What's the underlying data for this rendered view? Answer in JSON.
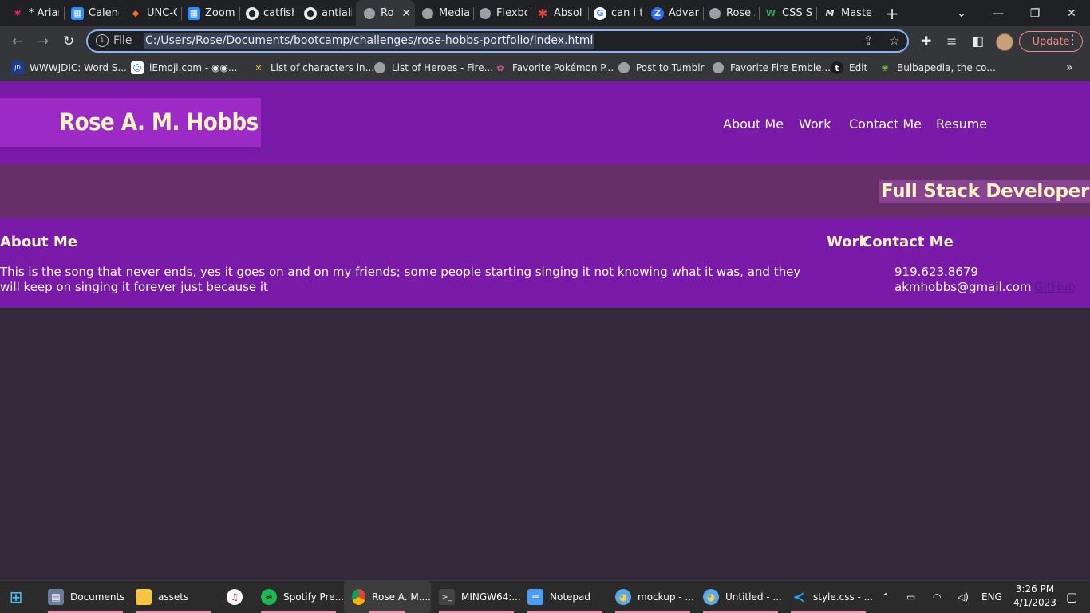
{
  "browser": {
    "tabs": [
      {
        "title": "* Arian",
        "icon": "slack-icon"
      },
      {
        "title": "Calend",
        "icon": "calendar-icon"
      },
      {
        "title": "UNC-C",
        "icon": "gitlab-icon"
      },
      {
        "title": "Zoom",
        "icon": "calendar-icon"
      },
      {
        "title": "catfish",
        "icon": "github-icon"
      },
      {
        "title": "antiali",
        "icon": "github-icon"
      },
      {
        "title": "Ro",
        "icon": "globe-icon",
        "active": true
      },
      {
        "title": "Media",
        "icon": "globe-icon"
      },
      {
        "title": "Flexbo",
        "icon": "globe-icon"
      },
      {
        "title": "Absol",
        "icon": "asterisk-icon"
      },
      {
        "title": "can i t",
        "icon": "google-icon"
      },
      {
        "title": "Advan",
        "icon": "z-icon"
      },
      {
        "title": "Rose A",
        "icon": "globe-icon"
      },
      {
        "title": "CSS Se",
        "icon": "w-icon"
      },
      {
        "title": "Maste",
        "icon": "m-icon"
      }
    ],
    "address": {
      "scheme_label": "File",
      "url": "C:/Users/Rose/Documents/bootcamp/challenges/rose-hobbs-portfolio/index.html"
    },
    "update_label": "Update",
    "bookmarks": [
      {
        "label": "WWWJDIC: Word S...",
        "icon": "wwwjdic-icon"
      },
      {
        "label": "iEmoji.com - ◉◉...",
        "icon": "emoji-icon"
      },
      {
        "label": "List of characters in...",
        "icon": "sword-icon"
      },
      {
        "label": "List of Heroes - Fire...",
        "icon": "globe-icon"
      },
      {
        "label": "Favorite Pokémon P...",
        "icon": "pokemon-icon"
      },
      {
        "label": "Post to Tumblr",
        "icon": "globe-icon"
      },
      {
        "label": "Favorite Fire Emble...",
        "icon": "globe-icon"
      },
      {
        "label": "Edit",
        "icon": "tumblr-icon"
      },
      {
        "label": "Bulbapedia, the co...",
        "icon": "bulbapedia-icon"
      }
    ]
  },
  "site": {
    "name": "Rose A. M. Hobbs",
    "nav": [
      "About Me",
      "Work",
      "Contact Me",
      "Resume"
    ],
    "hero_title": "Full Stack Developer",
    "about_heading": "About Me",
    "about_text": "This is the song that never ends, yes it goes on and on my friends; some people starting singing it not knowing what it was, and they will keep on singing it forever just because it",
    "work_heading": "Work",
    "contact_heading": "Contact Me",
    "phone": "919.623.8679",
    "email": "akmhobbs@gmail.com",
    "github_label": "GitHub"
  },
  "taskbar": {
    "items": [
      {
        "label": "Documents",
        "icon": "documents-icon"
      },
      {
        "label": "assets",
        "icon": "folder-icon"
      },
      {
        "label": "",
        "icon": "itunes-icon"
      },
      {
        "label": "Spotify Pre...",
        "icon": "spotify-icon"
      },
      {
        "label": "Rose A. M....",
        "icon": "chrome-icon",
        "active": true
      },
      {
        "label": "MINGW64:...",
        "icon": "terminal-icon"
      },
      {
        "label": "Notepad",
        "icon": "notepad-icon"
      },
      {
        "label": "mockup - ...",
        "icon": "paint-icon"
      },
      {
        "label": "Untitled - ...",
        "icon": "paint-icon"
      },
      {
        "label": "style.css - ...",
        "icon": "vscode-icon"
      }
    ],
    "language": "ENG",
    "time": "3:26 PM",
    "date": "4/1/2023"
  },
  "colors": {
    "header_purple": "#7a1aa8",
    "logo_purple": "#9b2bc4",
    "hero_band": "#652f6a",
    "cream_text": "#fff4c2",
    "page_bg": "#35283a"
  }
}
